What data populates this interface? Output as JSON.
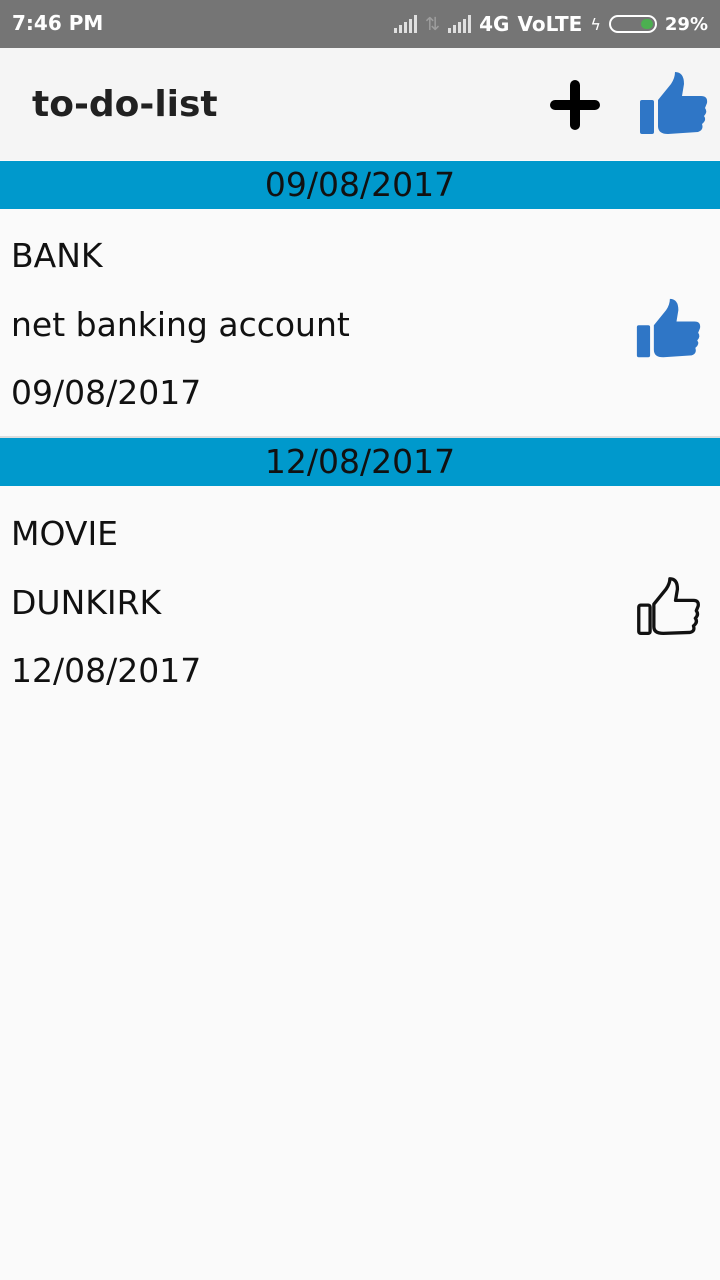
{
  "status_bar": {
    "time": "7:46 PM",
    "network": "4G",
    "volte": "VoLTE",
    "battery": "29%"
  },
  "app_bar": {
    "title": "to-do-list",
    "add_icon": "plus-icon",
    "like_icon": "thumbs-up-icon"
  },
  "groups": [
    {
      "date_header": "09/08/2017",
      "task": {
        "title": "BANK",
        "description": "net banking account",
        "date": "09/08/2017",
        "liked": true,
        "icon": "thumbs-up-filled-icon"
      }
    },
    {
      "date_header": "12/08/2017",
      "task": {
        "title": "MOVIE",
        "description": "DUNKIRK",
        "date": "12/08/2017",
        "liked": false,
        "icon": "thumbs-up-outline-icon"
      }
    }
  ],
  "colors": {
    "status_bar": "#757575",
    "header_band": "#0099cc",
    "like_blue": "#2f76c6"
  }
}
